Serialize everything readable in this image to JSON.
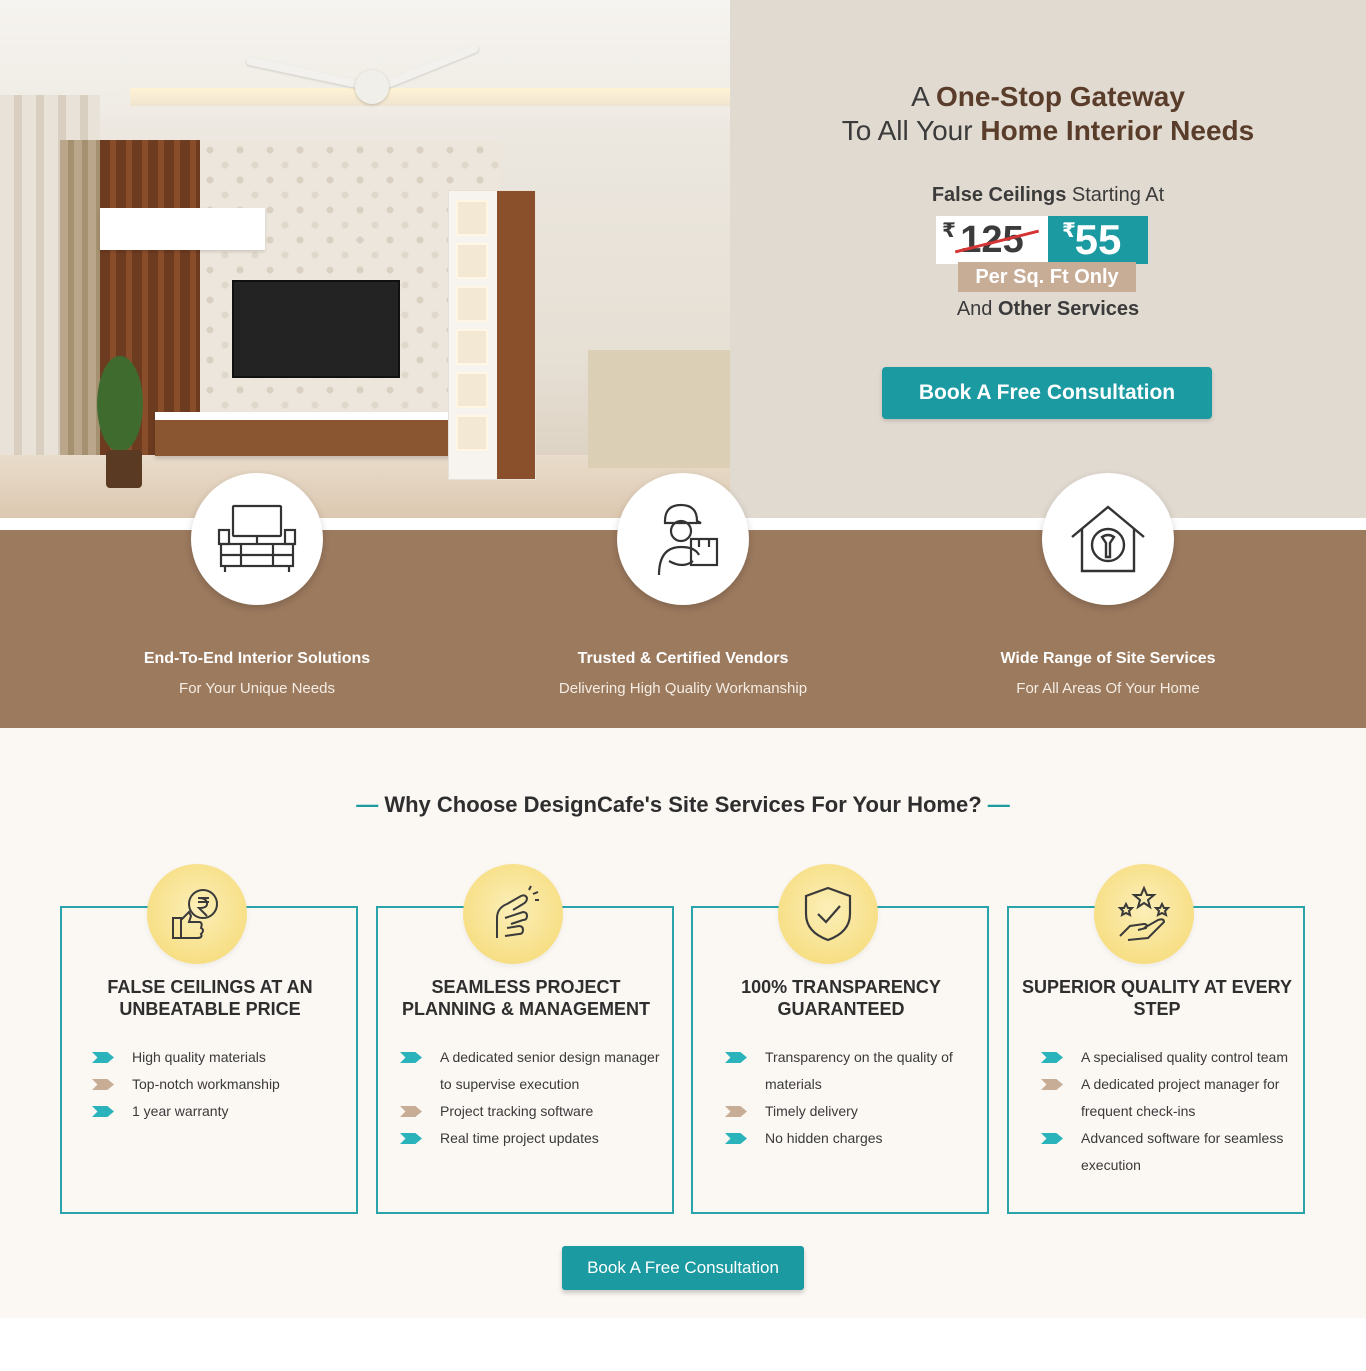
{
  "hero": {
    "title_prefix": "A",
    "title_bold_1": "One-Stop Gateway",
    "title_line2_prefix": "To All Your",
    "title_bold_2": "Home Interior Needs",
    "promo_bold": "False Ceilings",
    "promo_rest": "Starting At",
    "currency_symbol": "₹",
    "old_price": "125",
    "new_price": "55",
    "per_unit": "Per Sq. Ft Only",
    "services_prefix": "And",
    "services_bold": "Other Services",
    "cta_label": "Book A Free Consultation"
  },
  "features": [
    {
      "icon": "tv-unit-icon",
      "title": "End-To-End Interior Solutions",
      "subtitle": "For Your Unique Needs"
    },
    {
      "icon": "delivery-worker-icon",
      "title": "Trusted & Certified Vendors",
      "subtitle": "Delivering High Quality Workmanship"
    },
    {
      "icon": "house-wrench-icon",
      "title": "Wide Range of Site Services",
      "subtitle": "For All Areas Of Your Home"
    }
  ],
  "why": {
    "title": "Why Choose DesignCafe's Site Services For Your Home?",
    "dash": "—",
    "cards": [
      {
        "icon": "thumbs-up-rupee-icon",
        "title": "FALSE CEILINGS AT AN UNBEATABLE PRICE",
        "items": [
          "High quality materials",
          "Top-notch workmanship",
          "1 year warranty"
        ]
      },
      {
        "icon": "hand-pinch-icon",
        "title": "SEAMLESS PROJECT PLANNING & MANAGEMENT",
        "items": [
          "A dedicated senior design manager to supervise execution",
          "Project tracking software",
          "Real time project updates"
        ]
      },
      {
        "icon": "shield-check-icon",
        "title": "100% TRANSPARENCY GUARANTEED",
        "items": [
          "Transparency on the quality of materials",
          "Timely delivery",
          "No hidden charges"
        ]
      },
      {
        "icon": "hand-stars-icon",
        "title": "SUPERIOR QUALITY AT EVERY STEP",
        "items": [
          "A specialised quality control team",
          "A dedicated project manager for frequent check-ins",
          "Advanced software for seamless execution"
        ]
      }
    ],
    "cta_label": "Book A Free Consultation"
  },
  "colors": {
    "teal": "#1b9aa2",
    "brown_band": "#9c7a5e",
    "panel_bg": "#e1dad0",
    "tan": "#c8ad96",
    "strike_red": "#d63434"
  }
}
